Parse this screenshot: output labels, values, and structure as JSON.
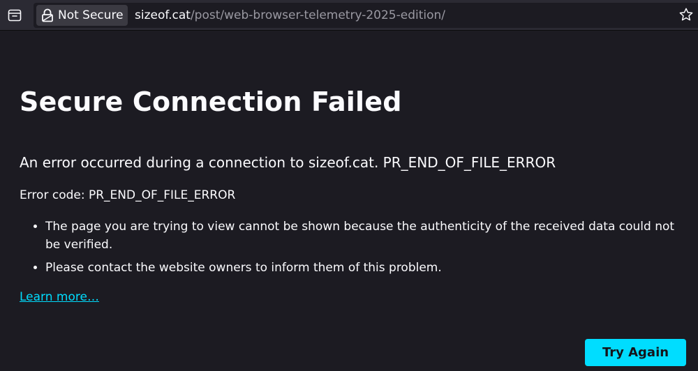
{
  "toolbar": {
    "tab_icon": "tab-list-icon",
    "identity": {
      "icon": "lock-warning-icon",
      "label": "Not Secure"
    },
    "url": {
      "domain": "sizeof.cat",
      "path": "/post/web-browser-telemetry-2025-edition/"
    },
    "bookmark_icon": "star-icon"
  },
  "error_page": {
    "title": "Secure Connection Failed",
    "short_description": "An error occurred during a connection to sizeof.cat. PR_END_OF_FILE_ERROR",
    "error_code_label": "Error code: PR_END_OF_FILE_ERROR",
    "details": [
      "The page you are trying to view cannot be shown because the authenticity of the received data could not be verified.",
      "Please contact the website owners to inform them of this problem."
    ],
    "learn_more": "Learn more…",
    "try_again": "Try Again"
  },
  "colors": {
    "background": "#1c1b22",
    "toolbar": "#2b2a33",
    "accent": "#00ddff",
    "text": "#fbfbfe",
    "url_path": "#9a99a2"
  }
}
